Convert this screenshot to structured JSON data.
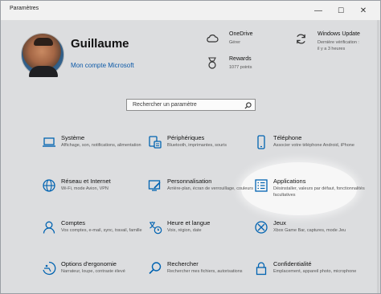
{
  "window": {
    "title": "Paramètres",
    "controls": {
      "minimize": "—",
      "maximize": "☐",
      "close": "✕"
    }
  },
  "account": {
    "name": "Guillaume",
    "link": "Mon compte Microsoft"
  },
  "header_items": [
    {
      "id": "onedrive",
      "icon": "cloud-icon",
      "name": "OneDrive",
      "sub": [
        "Gérer"
      ]
    },
    {
      "id": "rewards",
      "icon": "medal-icon",
      "name": "Rewards",
      "sub": [
        "1077 points"
      ]
    },
    {
      "id": "windows-update",
      "icon": "sync-icon",
      "name": "Windows Update",
      "sub": [
        "Dernière vérification :",
        "il y a 3 heures"
      ]
    }
  ],
  "search": {
    "placeholder": "Rechercher un paramètre",
    "icon": "search-icon"
  },
  "accent_color": "#0063b1",
  "categories": [
    {
      "id": "systeme",
      "icon": "laptop-icon",
      "name": "Système",
      "desc": "Affichage, son, notifications, alimentation"
    },
    {
      "id": "peripheriques",
      "icon": "keyboard-devices-icon",
      "name": "Périphériques",
      "desc": "Bluetooth, imprimantes, souris"
    },
    {
      "id": "telephone",
      "icon": "phone-icon",
      "name": "Téléphone",
      "desc": "Associer votre téléphone Android, iPhone"
    },
    {
      "id": "reseau",
      "icon": "globe-icon",
      "name": "Réseau et Internet",
      "desc": "Wi-Fi, mode Avion, VPN"
    },
    {
      "id": "personnalisation",
      "icon": "brush-icon",
      "name": "Personnalisation",
      "desc": "Arrière-plan, écran de verrouillage, couleurs"
    },
    {
      "id": "applications",
      "icon": "apps-list-icon",
      "name": "Applications",
      "desc": "Désinstaller, valeurs par défaut, fonctionnalités facultatives"
    },
    {
      "id": "comptes",
      "icon": "person-icon",
      "name": "Comptes",
      "desc": "Vos comptes, e-mail, sync, travail, famille"
    },
    {
      "id": "heure",
      "icon": "time-language-icon",
      "name": "Heure et langue",
      "desc": "Voix, région, date"
    },
    {
      "id": "jeux",
      "icon": "xbox-icon",
      "name": "Jeux",
      "desc": "Xbox Game Bar, captures, mode Jeu"
    },
    {
      "id": "ergonomie",
      "icon": "ease-of-access-icon",
      "name": "Options d'ergonomie",
      "desc": "Narrateur, loupe, contraste élevé"
    },
    {
      "id": "rechercher",
      "icon": "search-icon",
      "name": "Rechercher",
      "desc": "Rechercher mes fichiers, autorisations"
    },
    {
      "id": "confidentialite",
      "icon": "lock-icon",
      "name": "Confidentialité",
      "desc": "Emplacement, appareil photo, microphone"
    }
  ]
}
